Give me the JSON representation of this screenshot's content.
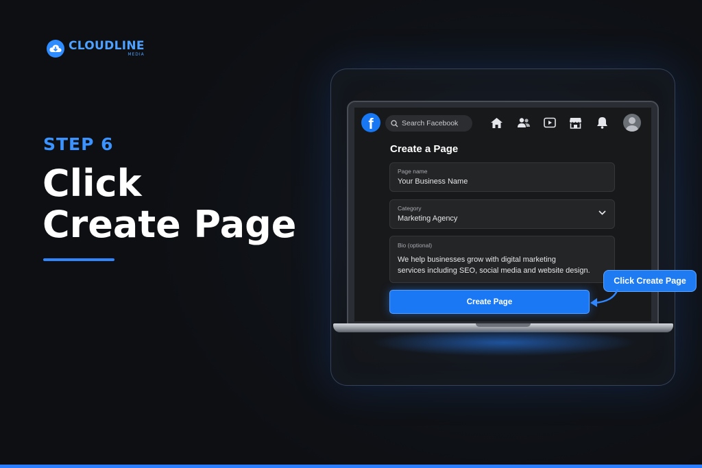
{
  "brand": {
    "name": "CLOUDLINE",
    "sub": "MEDIA"
  },
  "step": {
    "label": "STEP 6",
    "title_line1": "Click",
    "title_line2": "Create Page"
  },
  "facebook": {
    "logo": "f",
    "search_placeholder": "Search Facebook",
    "nav_icons": [
      "home-icon",
      "friends-icon",
      "watch-icon",
      "marketplace-icon",
      "bell-icon"
    ],
    "form": {
      "title": "Create a Page",
      "page_name": {
        "label": "Page name",
        "value": "Your Business Name"
      },
      "category": {
        "label": "Category",
        "value": "Marketing Agency"
      },
      "bio": {
        "label": "Bio (optional)",
        "line1": "We help businesses grow with digital marketing",
        "line2": "services including SEO, social media and website design."
      },
      "submit_label": "Create Page"
    }
  },
  "callout": {
    "text": "Click Create Page"
  },
  "colors": {
    "accent": "#2b7fff",
    "background": "#101318",
    "facebook_blue": "#1877f2"
  }
}
